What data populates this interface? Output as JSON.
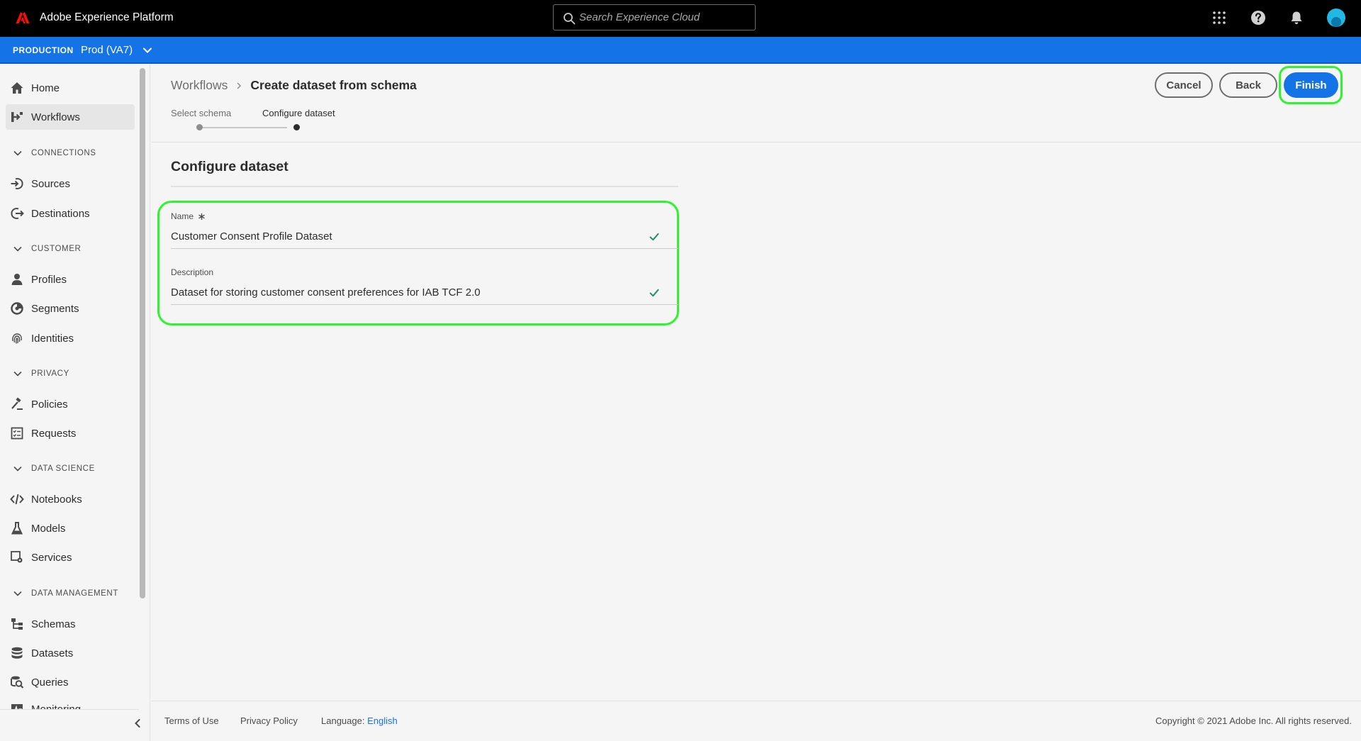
{
  "header": {
    "app_title": "Adobe Experience Platform",
    "search_placeholder": "Search Experience Cloud"
  },
  "environment": {
    "label": "PRODUCTION",
    "sandbox": "Prod (VA7)"
  },
  "sidebar": {
    "items": [
      {
        "label": "Home",
        "icon": "home-icon"
      },
      {
        "label": "Workflows",
        "icon": "workflows-icon"
      },
      {
        "section": "CONNECTIONS"
      },
      {
        "label": "Sources",
        "icon": "sources-icon"
      },
      {
        "label": "Destinations",
        "icon": "destinations-icon"
      },
      {
        "section": "CUSTOMER"
      },
      {
        "label": "Profiles",
        "icon": "profiles-icon"
      },
      {
        "label": "Segments",
        "icon": "segments-icon"
      },
      {
        "label": "Identities",
        "icon": "fingerprint-icon"
      },
      {
        "section": "PRIVACY"
      },
      {
        "label": "Policies",
        "icon": "policies-icon"
      },
      {
        "label": "Requests",
        "icon": "requests-icon"
      },
      {
        "section": "DATA SCIENCE"
      },
      {
        "label": "Notebooks",
        "icon": "code-icon"
      },
      {
        "label": "Models",
        "icon": "flask-icon"
      },
      {
        "label": "Services",
        "icon": "services-icon"
      },
      {
        "section": "DATA MANAGEMENT"
      },
      {
        "label": "Schemas",
        "icon": "schemas-icon"
      },
      {
        "label": "Datasets",
        "icon": "datasets-icon"
      },
      {
        "label": "Queries",
        "icon": "queries-icon"
      },
      {
        "label": "Monitoring",
        "icon": "monitoring-icon"
      }
    ],
    "active": "Workflows"
  },
  "breadcrumb": {
    "parent": "Workflows",
    "current": "Create dataset from schema"
  },
  "actions": {
    "cancel": "Cancel",
    "back": "Back",
    "finish": "Finish"
  },
  "steps": [
    {
      "label": "Select schema",
      "state": "complete"
    },
    {
      "label": "Configure dataset",
      "state": "current"
    }
  ],
  "form": {
    "title": "Configure dataset",
    "name_label": "Name",
    "name_value": "Customer Consent Profile Dataset",
    "description_label": "Description",
    "description_value": "Dataset for storing customer consent preferences for IAB TCF 2.0"
  },
  "footer": {
    "terms": "Terms of Use",
    "privacy": "Privacy Policy",
    "language_label": "Language:",
    "language_value": "English",
    "copyright": "Copyright ©  2021 Adobe Inc.  All rights reserved."
  },
  "colors": {
    "accent": "#1473e6",
    "highlight": "#2df52d",
    "valid": "#268e6c"
  }
}
